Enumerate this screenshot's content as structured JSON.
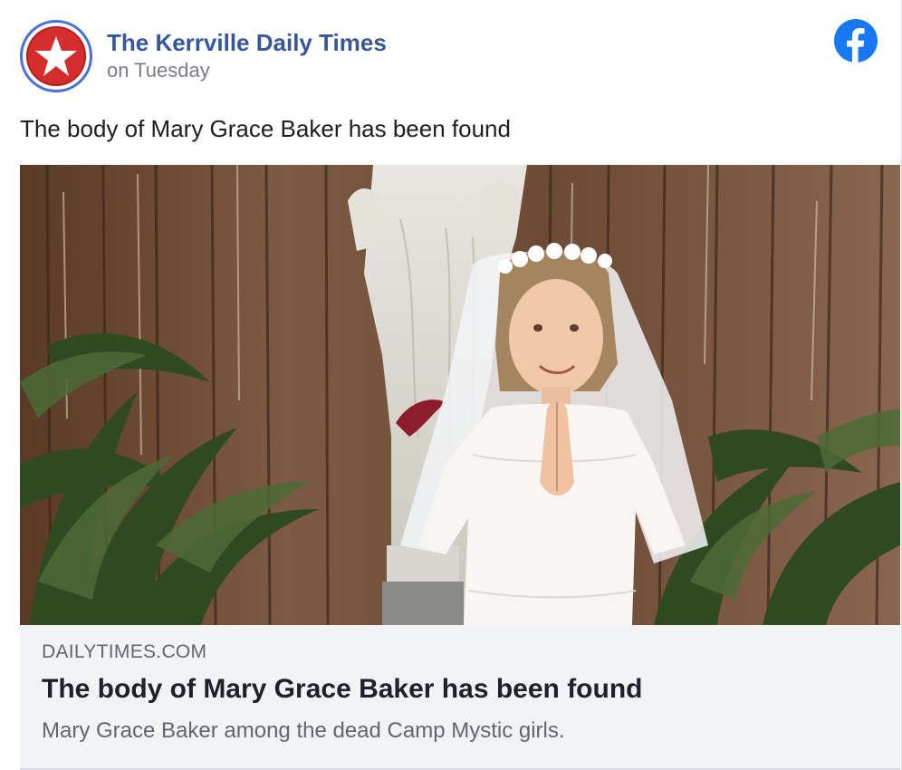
{
  "post": {
    "page_name": "The Kerrville Daily Times",
    "time": "on Tuesday",
    "text": "The body of Mary Grace Baker has been found",
    "avatar_icon": "red-star-logo-icon",
    "platform_icon": "facebook-icon"
  },
  "link_preview": {
    "domain": "DAILYTIMES.COM",
    "title": "The body of Mary Grace Baker has been found",
    "description": "Mary Grace Baker among the dead Camp Mystic girls."
  },
  "colors": {
    "page_name": "#365899",
    "facebook_blue": "#1877f2",
    "avatar_red": "#d52d2d",
    "avatar_ring": "#4a6fd8",
    "preview_bg": "#f2f3f5"
  }
}
